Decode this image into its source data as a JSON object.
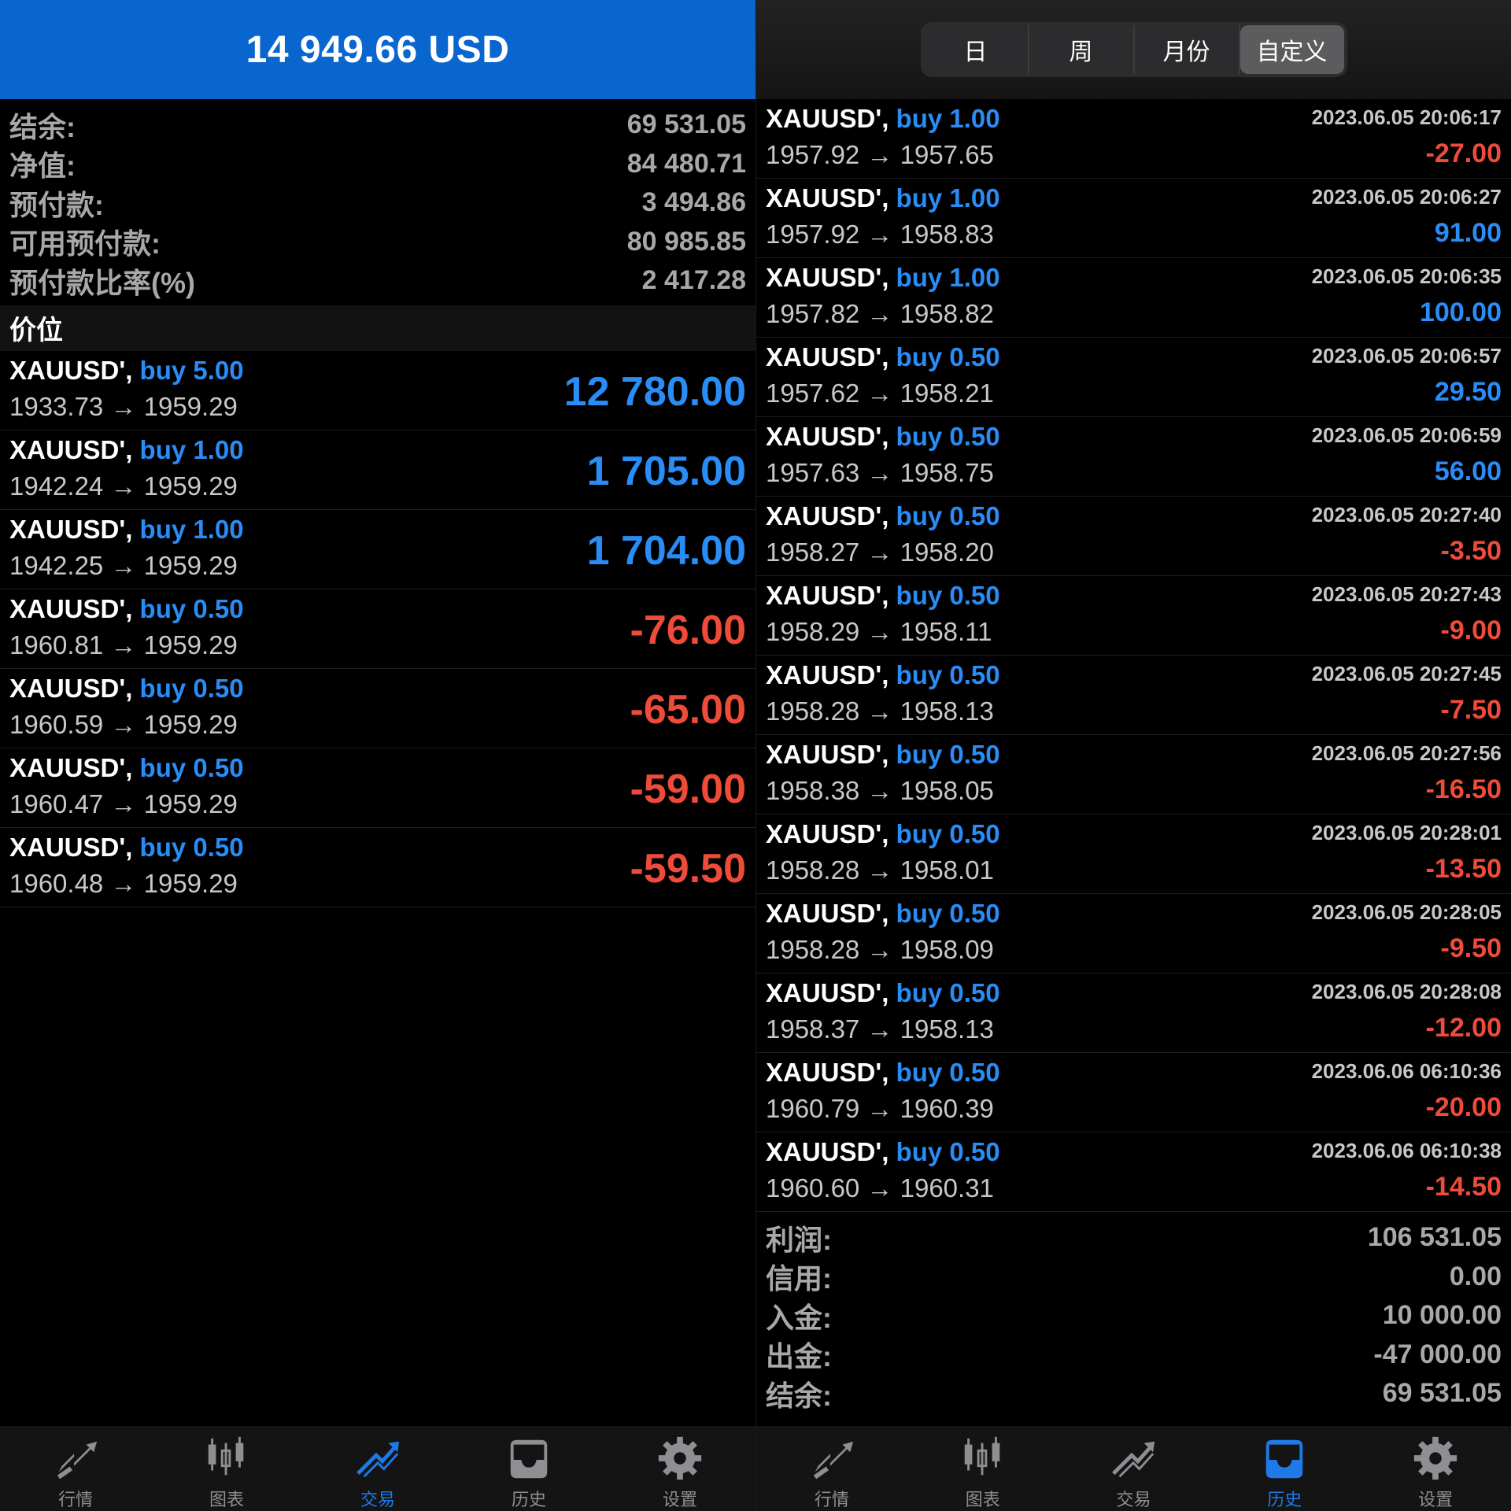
{
  "left": {
    "header_balance": "14 949.66 USD",
    "summary": [
      {
        "label": "结余:",
        "value": "69 531.05"
      },
      {
        "label": "净值:",
        "value": "84 480.71"
      },
      {
        "label": "预付款:",
        "value": "3 494.86"
      },
      {
        "label": "可用预付款:",
        "value": "80 985.85"
      },
      {
        "label": "预付款比率(%)",
        "value": "2 417.28"
      }
    ],
    "section_title": "价位",
    "positions": [
      {
        "symbol": "XAUUSD',",
        "type": "buy",
        "volume": "5.00",
        "prices": "1933.73 → 1959.29",
        "profit": "12 780.00",
        "sign": "pos"
      },
      {
        "symbol": "XAUUSD',",
        "type": "buy",
        "volume": "1.00",
        "prices": "1942.24 → 1959.29",
        "profit": "1 705.00",
        "sign": "pos"
      },
      {
        "symbol": "XAUUSD',",
        "type": "buy",
        "volume": "1.00",
        "prices": "1942.25 → 1959.29",
        "profit": "1 704.00",
        "sign": "pos"
      },
      {
        "symbol": "XAUUSD',",
        "type": "buy",
        "volume": "0.50",
        "prices": "1960.81 → 1959.29",
        "profit": "-76.00",
        "sign": "neg"
      },
      {
        "symbol": "XAUUSD',",
        "type": "buy",
        "volume": "0.50",
        "prices": "1960.59 → 1959.29",
        "profit": "-65.00",
        "sign": "neg"
      },
      {
        "symbol": "XAUUSD',",
        "type": "buy",
        "volume": "0.50",
        "prices": "1960.47 → 1959.29",
        "profit": "-59.00",
        "sign": "neg"
      },
      {
        "symbol": "XAUUSD',",
        "type": "buy",
        "volume": "0.50",
        "prices": "1960.48 → 1959.29",
        "profit": "-59.50",
        "sign": "neg"
      }
    ],
    "tabs": [
      {
        "label": "行情",
        "icon": "quotes-icon",
        "active": false
      },
      {
        "label": "图表",
        "icon": "chart-icon",
        "active": false
      },
      {
        "label": "交易",
        "icon": "trade-icon",
        "active": true
      },
      {
        "label": "历史",
        "icon": "history-icon",
        "active": false
      },
      {
        "label": "设置",
        "icon": "settings-icon",
        "active": false
      }
    ]
  },
  "right": {
    "segments": [
      {
        "label": "日",
        "active": false
      },
      {
        "label": "周",
        "active": false
      },
      {
        "label": "月份",
        "active": false
      },
      {
        "label": "自定义",
        "active": true
      }
    ],
    "history": [
      {
        "symbol": "XAUUSD',",
        "type": "buy",
        "volume": "1.00",
        "prices": "1957.92 → 1957.65",
        "datetime": "2023.06.05 20:06:17",
        "profit": "-27.00",
        "sign": "neg"
      },
      {
        "symbol": "XAUUSD',",
        "type": "buy",
        "volume": "1.00",
        "prices": "1957.92 → 1958.83",
        "datetime": "2023.06.05 20:06:27",
        "profit": "91.00",
        "sign": "pos"
      },
      {
        "symbol": "XAUUSD',",
        "type": "buy",
        "volume": "1.00",
        "prices": "1957.82 → 1958.82",
        "datetime": "2023.06.05 20:06:35",
        "profit": "100.00",
        "sign": "pos"
      },
      {
        "symbol": "XAUUSD',",
        "type": "buy",
        "volume": "0.50",
        "prices": "1957.62 → 1958.21",
        "datetime": "2023.06.05 20:06:57",
        "profit": "29.50",
        "sign": "pos"
      },
      {
        "symbol": "XAUUSD',",
        "type": "buy",
        "volume": "0.50",
        "prices": "1957.63 → 1958.75",
        "datetime": "2023.06.05 20:06:59",
        "profit": "56.00",
        "sign": "pos"
      },
      {
        "symbol": "XAUUSD',",
        "type": "buy",
        "volume": "0.50",
        "prices": "1958.27 → 1958.20",
        "datetime": "2023.06.05 20:27:40",
        "profit": "-3.50",
        "sign": "neg"
      },
      {
        "symbol": "XAUUSD',",
        "type": "buy",
        "volume": "0.50",
        "prices": "1958.29 → 1958.11",
        "datetime": "2023.06.05 20:27:43",
        "profit": "-9.00",
        "sign": "neg"
      },
      {
        "symbol": "XAUUSD',",
        "type": "buy",
        "volume": "0.50",
        "prices": "1958.28 → 1958.13",
        "datetime": "2023.06.05 20:27:45",
        "profit": "-7.50",
        "sign": "neg"
      },
      {
        "symbol": "XAUUSD',",
        "type": "buy",
        "volume": "0.50",
        "prices": "1958.38 → 1958.05",
        "datetime": "2023.06.05 20:27:56",
        "profit": "-16.50",
        "sign": "neg"
      },
      {
        "symbol": "XAUUSD',",
        "type": "buy",
        "volume": "0.50",
        "prices": "1958.28 → 1958.01",
        "datetime": "2023.06.05 20:28:01",
        "profit": "-13.50",
        "sign": "neg"
      },
      {
        "symbol": "XAUUSD',",
        "type": "buy",
        "volume": "0.50",
        "prices": "1958.28 → 1958.09",
        "datetime": "2023.06.05 20:28:05",
        "profit": "-9.50",
        "sign": "neg"
      },
      {
        "symbol": "XAUUSD',",
        "type": "buy",
        "volume": "0.50",
        "prices": "1958.37 → 1958.13",
        "datetime": "2023.06.05 20:28:08",
        "profit": "-12.00",
        "sign": "neg"
      },
      {
        "symbol": "XAUUSD',",
        "type": "buy",
        "volume": "0.50",
        "prices": "1960.79 → 1960.39",
        "datetime": "2023.06.06 06:10:36",
        "profit": "-20.00",
        "sign": "neg"
      },
      {
        "symbol": "XAUUSD',",
        "type": "buy",
        "volume": "0.50",
        "prices": "1960.60 → 1960.31",
        "datetime": "2023.06.06 06:10:38",
        "profit": "-14.50",
        "sign": "neg"
      }
    ],
    "summary": [
      {
        "label": "利润:",
        "value": "106 531.05"
      },
      {
        "label": "信用:",
        "value": "0.00"
      },
      {
        "label": "入金:",
        "value": "10 000.00"
      },
      {
        "label": "出金:",
        "value": "-47 000.00"
      },
      {
        "label": "结余:",
        "value": "69 531.05"
      }
    ],
    "tabs": [
      {
        "label": "行情",
        "icon": "quotes-icon",
        "active": false
      },
      {
        "label": "图表",
        "icon": "chart-icon",
        "active": false
      },
      {
        "label": "交易",
        "icon": "trade-icon",
        "active": false
      },
      {
        "label": "历史",
        "icon": "history-icon",
        "active": true
      },
      {
        "label": "设置",
        "icon": "settings-icon",
        "active": false
      }
    ]
  },
  "colors": {
    "accent_blue": "#0a66cf",
    "profit_blue": "#2a8cf5",
    "loss_red": "#ee4b3b",
    "tab_active": "#1f7ae8"
  }
}
